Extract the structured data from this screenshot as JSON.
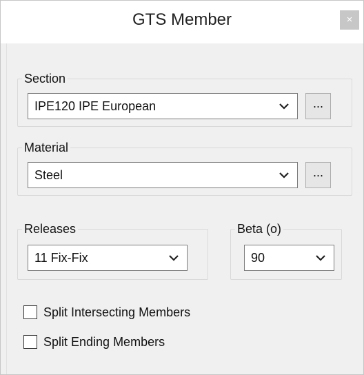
{
  "window": {
    "title": "GTS Member",
    "close_label": "×"
  },
  "section": {
    "legend": "Section",
    "value": "IPE120 IPE European",
    "browse_label": "..."
  },
  "material": {
    "legend": "Material",
    "value": "Steel",
    "browse_label": "..."
  },
  "releases": {
    "legend": "Releases",
    "value": "11 Fix-Fix"
  },
  "beta": {
    "legend": "Beta (o)",
    "value": "90"
  },
  "options": {
    "split_intersecting": {
      "label": "Split Intersecting Members",
      "checked": false
    },
    "split_ending": {
      "label": "Split Ending Members",
      "checked": false
    }
  },
  "icons": {
    "dropdown": "chevron-down-icon"
  }
}
